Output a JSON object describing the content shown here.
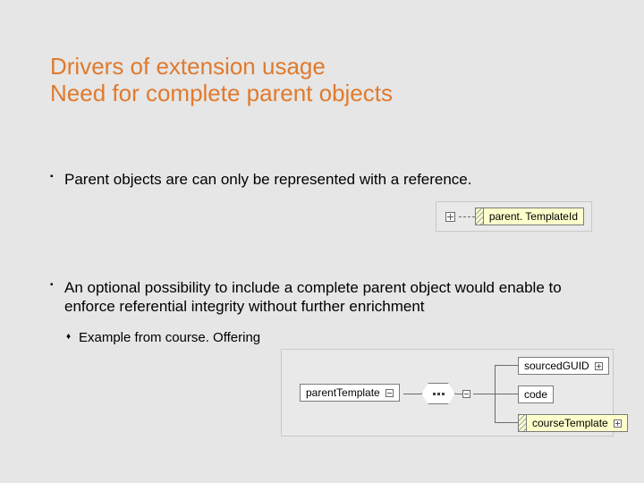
{
  "title": {
    "line1": "Drivers of extension usage",
    "line2": "Need for complete parent objects"
  },
  "bullets": {
    "b1": "Parent objects are can only be represented with a reference.",
    "b2": "An optional possibility to include a complete parent object would enable to enforce referential integrity without further enrichment",
    "b2_sub1": "Example from course. Offering"
  },
  "diagram1": {
    "node_label": "parent. TemplateId"
  },
  "diagram2": {
    "parent_label": "parentTemplate",
    "guid_label": "sourcedGUID",
    "code_label": "code",
    "course_label": "courseTemplate"
  }
}
